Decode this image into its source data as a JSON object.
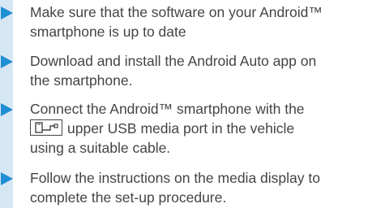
{
  "colors": {
    "accent": "#1f8fd3",
    "band": "#d6e7f4",
    "text": "#444444"
  },
  "steps": [
    {
      "lines": [
        "Make sure that the software on your Android™",
        "smartphone is up to date"
      ]
    },
    {
      "lines": [
        "Download and install the Android Auto app on",
        "the smartphone."
      ]
    },
    {
      "lines": [
        "Connect the Android™ smartphone with the",
        "upper USB media port in the vehicle",
        "using a suitable cable."
      ],
      "icon": "usb-phone-icon"
    },
    {
      "lines": [
        "Follow the instructions on the media display to",
        "complete the set-up procedure."
      ]
    }
  ]
}
